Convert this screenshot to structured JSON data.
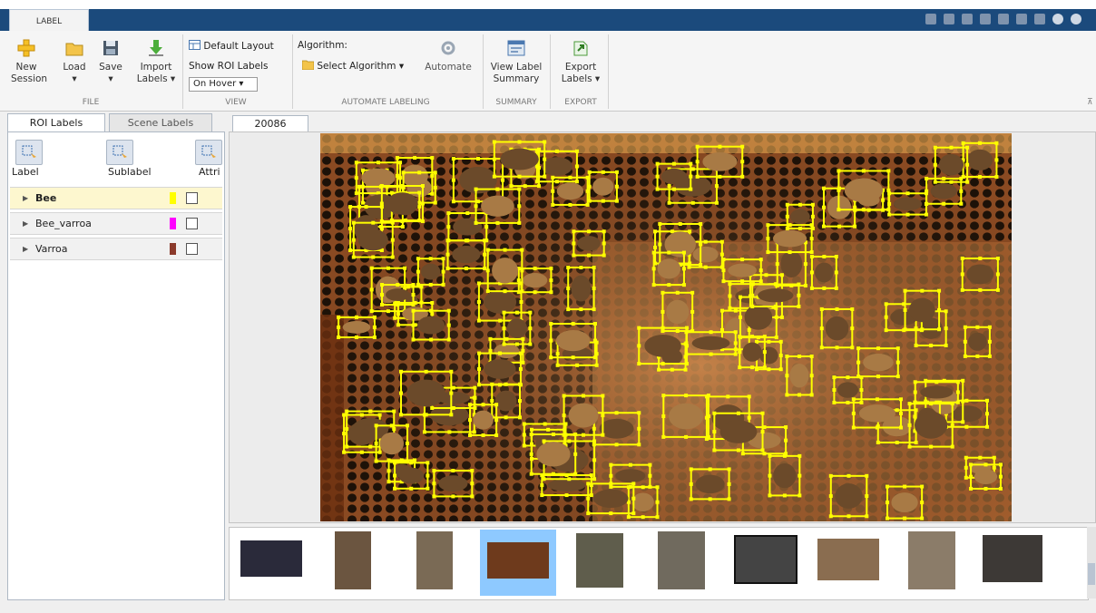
{
  "app": {
    "tab": "LABEL"
  },
  "toolstrip": {
    "file": {
      "section": "FILE",
      "new_session": [
        "New",
        "Session"
      ],
      "load": [
        "Load",
        "▾"
      ],
      "save": [
        "Save",
        "▾"
      ],
      "import_labels": [
        "Import",
        "Labels ▾"
      ]
    },
    "view": {
      "section": "VIEW",
      "default_layout": "Default Layout",
      "show_roi_labels": "Show ROI Labels",
      "roi_mode": "On Hover ▾"
    },
    "automate": {
      "section": "AUTOMATE LABELING",
      "algorithm_label": "Algorithm:",
      "select_algorithm": "Select Algorithm ▾",
      "automate": "Automate"
    },
    "summary": {
      "section": "SUMMARY",
      "view_label_summary": [
        "View Label",
        "Summary"
      ]
    },
    "export": {
      "section": "EXPORT",
      "export_labels": [
        "Export",
        "Labels ▾"
      ]
    }
  },
  "left_panel": {
    "tabs": [
      "ROI Labels",
      "Scene Labels"
    ],
    "buttons": {
      "label": "Label",
      "sublabel": "Sublabel",
      "attribute": "Attri"
    },
    "labels": [
      {
        "name": "Bee",
        "color": "#ffff00",
        "selected": true
      },
      {
        "name": "Bee_varroa",
        "color": "#ff00ff",
        "selected": false
      },
      {
        "name": "Varroa",
        "color": "#8b3a2b",
        "selected": false
      }
    ]
  },
  "document": {
    "tab": "20086"
  },
  "colors": {
    "ribbon_blue": "#1b4a7c",
    "bee_box": "#ffff00",
    "selection": "#8ec9ff"
  },
  "filmstrip": {
    "count": 10,
    "selected_index": 3
  }
}
